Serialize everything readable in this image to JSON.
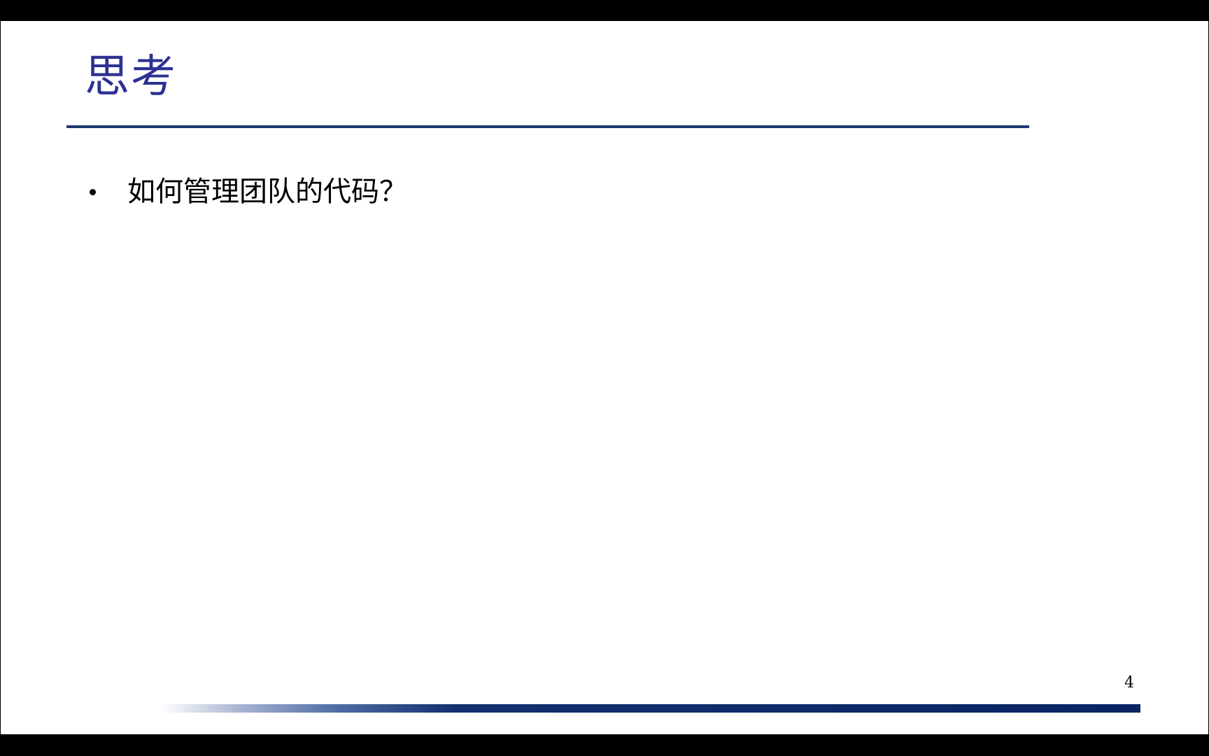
{
  "slide": {
    "title": "思考",
    "bullets": [
      {
        "text": "如何管理团队的代码？"
      }
    ],
    "page_number": "4"
  },
  "colors": {
    "title": "#2e3192",
    "rule": "#1f3a6e",
    "footer_bar": "#0a2462",
    "letterbox": "#000000",
    "background": "#ffffff"
  }
}
